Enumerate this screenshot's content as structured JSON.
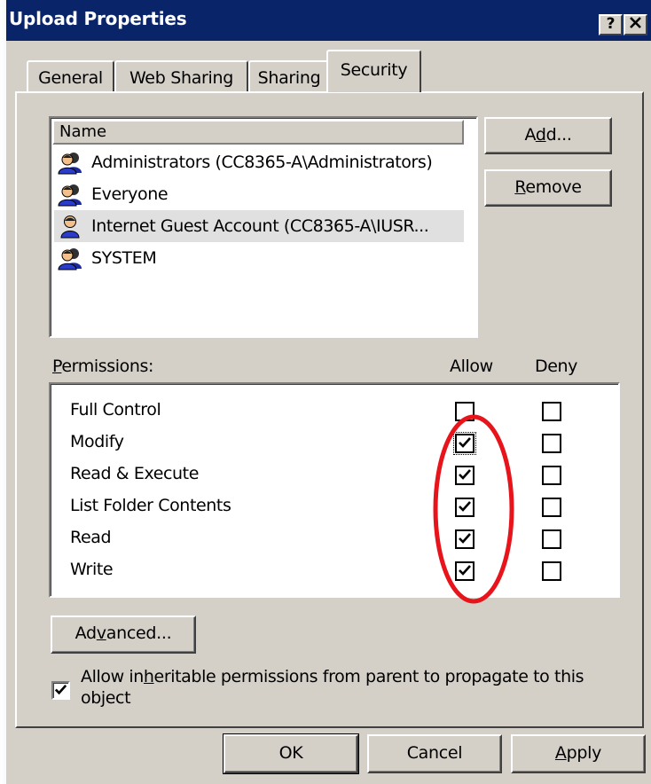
{
  "window": {
    "title": "Upload Properties",
    "help_button": "?",
    "close_button": "✕"
  },
  "tabs": [
    {
      "label": "General"
    },
    {
      "label": "Web Sharing"
    },
    {
      "label": "Sharing"
    },
    {
      "label": "Security",
      "active": true
    }
  ],
  "users_list": {
    "column_header": "Name",
    "items": [
      {
        "name": "Administrators (CC8365-A\\Administrators)",
        "icon": "user-group-icon"
      },
      {
        "name": "Everyone",
        "icon": "user-group-icon"
      },
      {
        "name": "Internet Guest Account (CC8365-A\\IUSR...",
        "icon": "single-user-icon",
        "selected": true
      },
      {
        "name": "SYSTEM",
        "icon": "user-group-icon"
      }
    ]
  },
  "buttons": {
    "add_pre": "A",
    "add_u": "d",
    "add_post": "d...",
    "remove_u": "R",
    "remove_post": "emove",
    "advanced_pre": "Ad",
    "advanced_u": "v",
    "advanced_post": "anced...",
    "ok": "OK",
    "cancel": "Cancel",
    "apply_u": "A",
    "apply_post": "pply"
  },
  "permissions": {
    "label_u": "P",
    "label_post": "ermissions:",
    "allow_header": "Allow",
    "deny_header": "Deny",
    "rows": [
      {
        "name": "Full Control",
        "allow": false,
        "deny": false
      },
      {
        "name": "Modify",
        "allow": true,
        "deny": false,
        "focused": true
      },
      {
        "name": "Read & Execute",
        "allow": true,
        "deny": false
      },
      {
        "name": "List Folder Contents",
        "allow": true,
        "deny": false
      },
      {
        "name": "Read",
        "allow": true,
        "deny": false
      },
      {
        "name": "Write",
        "allow": true,
        "deny": false
      }
    ]
  },
  "inherit": {
    "checked": true,
    "line1_pre": "Allow in",
    "line1_u": "h",
    "line1_post": "eritable permissions from parent to propagate to this",
    "line2": "object"
  },
  "annotation": {
    "shape": "ellipse",
    "color": "#e8141b",
    "target": "allow-column"
  },
  "colors": {
    "titlebar": "#0a246a",
    "face": "#d4d0c8",
    "annotation": "#e8141b"
  }
}
